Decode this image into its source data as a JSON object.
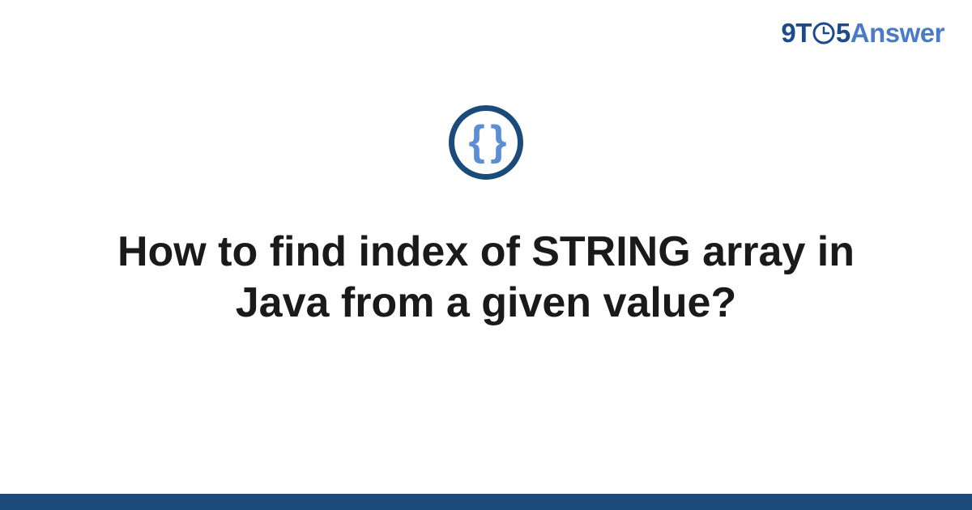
{
  "brand": {
    "part1": "9T",
    "part2": "5",
    "part3": "Answer"
  },
  "category_icon": {
    "name": "code-braces-icon",
    "glyph": "{ }"
  },
  "question": {
    "title": "How to find index of STRING array in Java from a given value?"
  },
  "colors": {
    "ring": "#1a4b7a",
    "braces": "#5a8fd4",
    "brand_dark": "#1e4a8a",
    "brand_light": "#4a7bc8",
    "bar": "#1a4b7a"
  }
}
